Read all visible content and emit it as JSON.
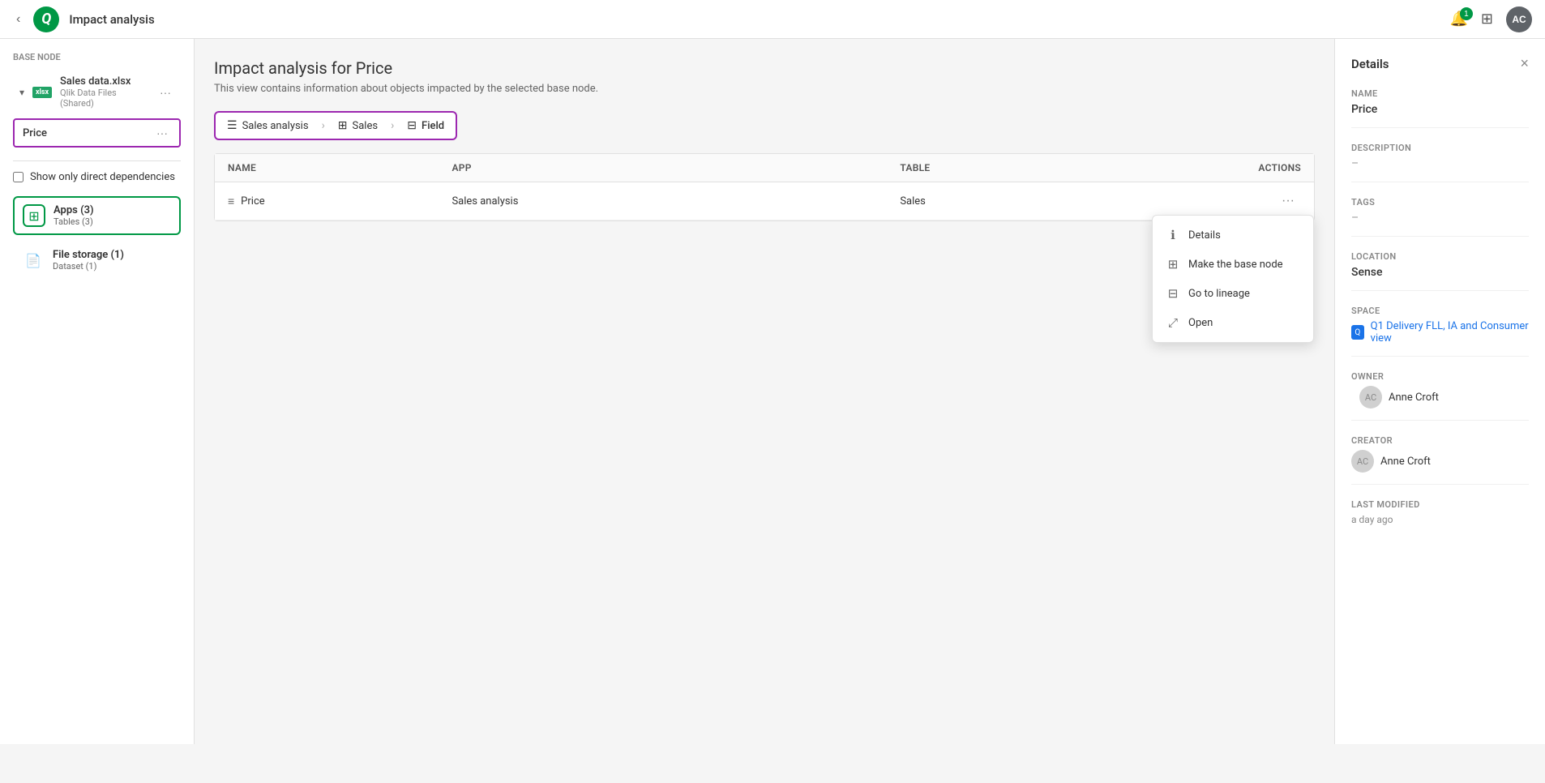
{
  "topbar": {
    "back_label": "‹",
    "title": "Impact analysis",
    "notification_count": "1",
    "avatar_label": "AC"
  },
  "sidebar": {
    "base_node_label": "Base node",
    "file_name": "Sales data.xlsx",
    "file_sub": "Qlik Data Files (Shared)",
    "price_label": "Price",
    "price_menu": "···",
    "checkbox_label": "Show only direct dependencies",
    "apps_label": "Apps",
    "apps_count": "(3)",
    "apps_sub": "Tables (3)",
    "file_storage_label": "File storage",
    "file_storage_count": "(1)",
    "file_storage_sub": "Dataset (1)"
  },
  "main": {
    "page_title": "Impact analysis for Price",
    "page_subtitle": "This view contains information about objects impacted by the selected base node.",
    "breadcrumb": [
      {
        "label": "Sales analysis",
        "icon": "☰",
        "active": false
      },
      {
        "label": "Sales",
        "icon": "⊞",
        "active": false
      },
      {
        "label": "Field",
        "icon": "⊟",
        "active": true
      }
    ],
    "table": {
      "headers": [
        "Name",
        "App",
        "Table",
        "Actions"
      ],
      "rows": [
        {
          "name": "Price",
          "icon": "≡",
          "app": "Sales analysis",
          "table": "Sales"
        }
      ]
    }
  },
  "context_menu": {
    "items": [
      {
        "label": "Details",
        "icon": "ℹ"
      },
      {
        "label": "Make the base node",
        "icon": "⊞"
      },
      {
        "label": "Go to lineage",
        "icon": "⊟"
      },
      {
        "label": "Open",
        "icon": "⤢"
      }
    ]
  },
  "details": {
    "title": "Details",
    "close_icon": "×",
    "name_label": "Name",
    "name_value": "Price",
    "description_label": "Description",
    "description_dash": "–",
    "tags_label": "Tags",
    "tags_dash": "–",
    "location_label": "Location",
    "location_value": "Sense",
    "space_label": "Space",
    "space_name": "Q1 Delivery FLL, IA and Consumer view",
    "owner_label": "Owner",
    "owner_name": "Anne Croft",
    "creator_label": "Creator",
    "creator_name": "Anne Croft",
    "last_modified_label": "Last modified",
    "last_modified_value": "a day ago"
  }
}
